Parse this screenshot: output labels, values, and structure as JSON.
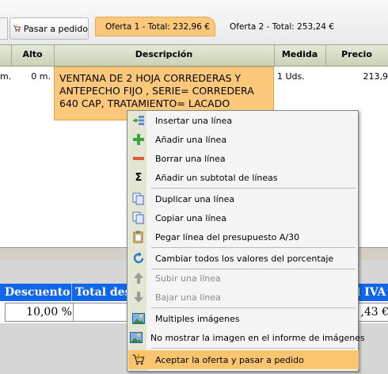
{
  "toolbar": {
    "pasar_label": "Pasar a pedido",
    "tabs": [
      {
        "label": "Oferta 1 - Total: 232,96 €"
      },
      {
        "label": "Oferta 2 - Total: 253,24 €"
      }
    ]
  },
  "grid": {
    "columns": [
      "Alto",
      "Descripción",
      "Medida",
      "Precio"
    ],
    "row": {
      "first_partial": "m.",
      "alto": "0 m.",
      "descripcion_lines": [
        "VENTANA DE 2 HOJA CORREDERAS Y",
        "ANTEPECHO FIJO , SERIE= CORREDERA",
        "640 CAP,  TRATAMIENTO=  LACADO"
      ],
      "medida": "1 Uds.",
      "precio": "213,9"
    }
  },
  "totals": {
    "headers": [
      "Descuento",
      "Total des",
      "l IVA"
    ],
    "values": [
      "10,00 %",
      "",
      ",43 €"
    ]
  },
  "context_menu": {
    "items": [
      {
        "label": "Insertar una línea",
        "icon": "insert-row-icon",
        "enabled": true
      },
      {
        "label": "Añadir una línea",
        "icon": "plus-icon",
        "enabled": true
      },
      {
        "label": "Borrar una línea",
        "icon": "minus-icon",
        "enabled": true
      },
      {
        "label": "Añadir un subtotal de líneas",
        "icon": "sigma-icon",
        "enabled": true
      },
      {
        "label": "Duplicar una línea",
        "icon": "duplicate-icon",
        "enabled": true
      },
      {
        "label": "Copiar una línea",
        "icon": "copy-icon",
        "enabled": true
      },
      {
        "label": "Pegar línea del presupuesto A/30",
        "icon": "paste-icon",
        "enabled": true
      },
      {
        "label": "Cambiar todos los valores del porcentaje",
        "icon": "refresh-icon",
        "enabled": true
      },
      {
        "label": "Subir una línea",
        "icon": "arrow-up-icon",
        "enabled": false
      },
      {
        "label": "Bajar una línea",
        "icon": "arrow-down-icon",
        "enabled": false
      },
      {
        "label": "Multiples imágenes",
        "icon": "image-icon",
        "enabled": true
      },
      {
        "label": "No mostrar la imagen en el informe de imágenes",
        "icon": "image-icon",
        "enabled": true
      },
      {
        "label": "Aceptar la oferta y pasar a pedido",
        "icon": "cart-icon",
        "enabled": true,
        "highlighted": true
      }
    ]
  },
  "colors": {
    "tab_active": "#fcc87c",
    "menu_highlight": "#fbc56f",
    "totals_header": "#1167ea",
    "grid_header": "#c9d2b5"
  }
}
